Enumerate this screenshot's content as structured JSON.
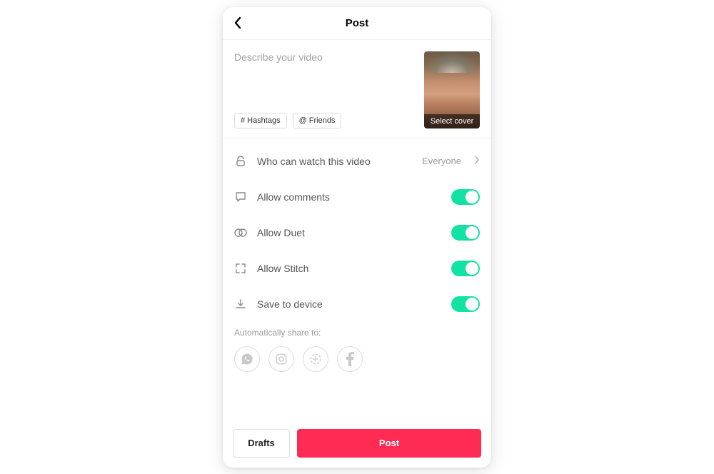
{
  "header": {
    "title": "Post"
  },
  "caption": {
    "placeholder": "Describe your video",
    "hashtags_label": "Hashtags",
    "friends_label": "Friends",
    "cover_label": "Select cover"
  },
  "settings": {
    "privacy": {
      "label": "Who can watch this video",
      "value": "Everyone"
    },
    "comments": {
      "label": "Allow comments",
      "on": true
    },
    "duet": {
      "label": "Allow Duet",
      "on": true
    },
    "stitch": {
      "label": "Allow Stitch",
      "on": true
    },
    "save": {
      "label": "Save to device",
      "on": true
    }
  },
  "share": {
    "label": "Automatically share to:",
    "targets": [
      "whatsapp",
      "instagram",
      "stories",
      "facebook"
    ]
  },
  "footer": {
    "drafts": "Drafts",
    "post": "Post"
  },
  "colors": {
    "accent": "#fe2c55",
    "toggle_on": "#12e2a3"
  }
}
